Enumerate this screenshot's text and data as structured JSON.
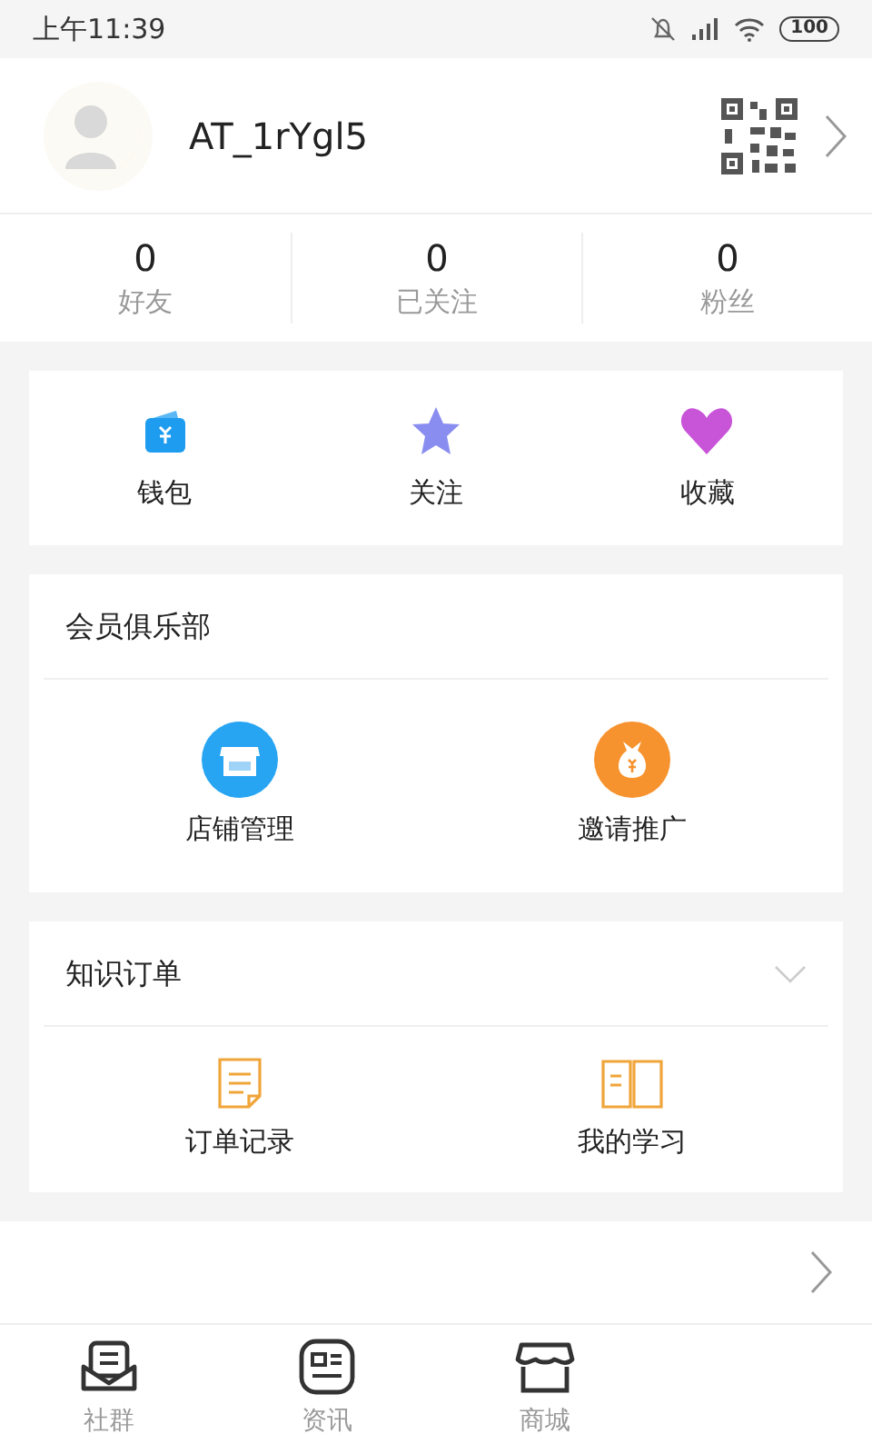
{
  "status_bar": {
    "time": "上午11:39",
    "battery": "100"
  },
  "profile": {
    "username": "AT_1rYgl5"
  },
  "stats": [
    {
      "value": "0",
      "label": "好友"
    },
    {
      "value": "0",
      "label": "已关注"
    },
    {
      "value": "0",
      "label": "粉丝"
    }
  ],
  "shortcuts": [
    {
      "kind": "wallet",
      "label": "钱包"
    },
    {
      "kind": "star",
      "label": "关注"
    },
    {
      "kind": "heart",
      "label": "收藏"
    }
  ],
  "member_club": {
    "title": "会员俱乐部",
    "items": [
      {
        "kind": "store",
        "label": "店铺管理"
      },
      {
        "kind": "moneybag",
        "label": "邀请推广"
      }
    ]
  },
  "knowledge_orders": {
    "title": "知识订单",
    "expanded": false,
    "items": [
      {
        "kind": "document",
        "label": "订单记录"
      },
      {
        "kind": "book",
        "label": "我的学习"
      }
    ]
  },
  "bottom_nav": [
    {
      "kind": "community",
      "label": "社群"
    },
    {
      "kind": "news",
      "label": "资讯"
    },
    {
      "kind": "shop",
      "label": "商城"
    }
  ]
}
